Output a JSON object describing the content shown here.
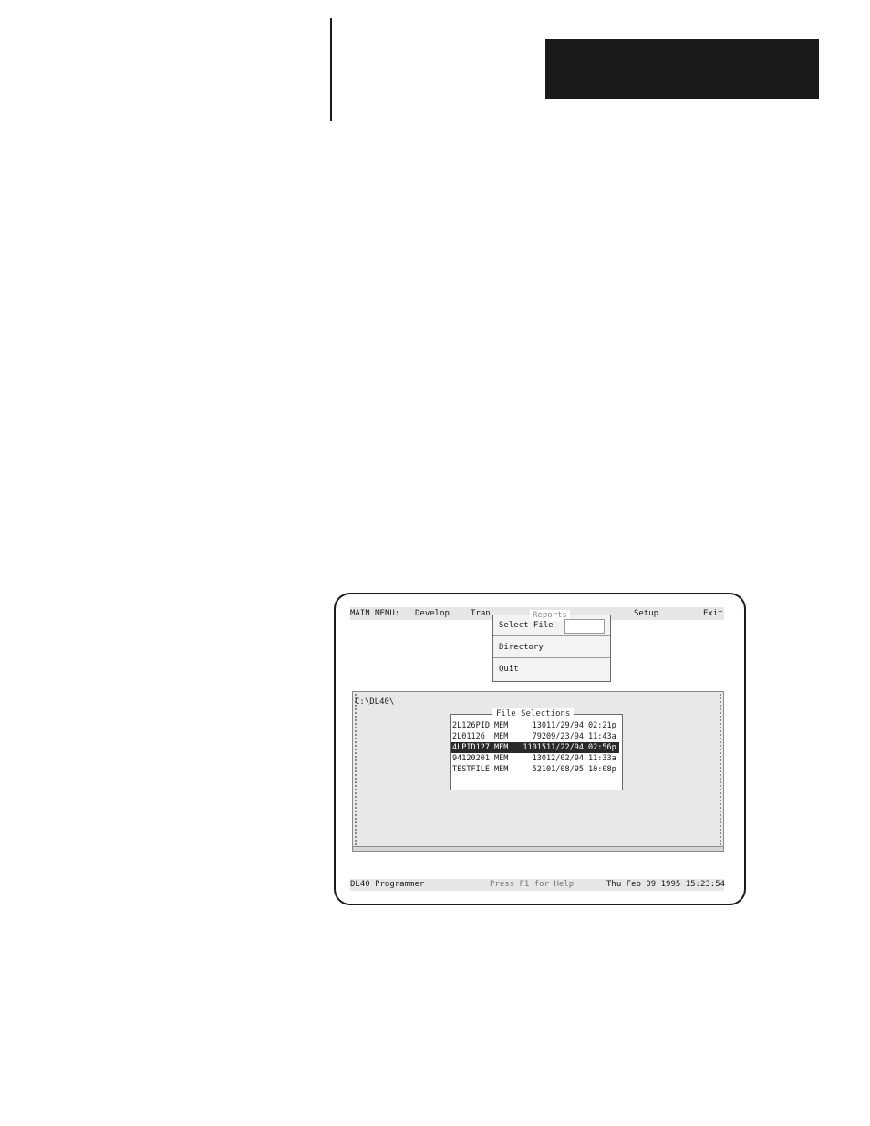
{
  "menu": {
    "main_label": "MAIN MENU:",
    "develop": "Develop",
    "tran": "Tran",
    "setup": "Setup",
    "exit": "Exit"
  },
  "reports_menu": {
    "title": "Reports",
    "items": [
      "Select File",
      "Directory",
      "Quit"
    ]
  },
  "directory": {
    "path": "C:\\DL40\\"
  },
  "file_selections": {
    "title": "File Selections",
    "rows": [
      {
        "name": "2L126PID.MEM",
        "size": "130",
        "date": "11/29/94",
        "time": "02:21p",
        "selected": false
      },
      {
        "name": "2L01126 .MEM",
        "size": "792",
        "date": "09/23/94",
        "time": "11:43a",
        "selected": false
      },
      {
        "name": "4LPID127.MEM",
        "size": "11015",
        "date": "11/22/94",
        "time": "02:56p",
        "selected": true
      },
      {
        "name": "94120201.MEM",
        "size": "130",
        "date": "12/02/94",
        "time": "11:33a",
        "selected": false
      },
      {
        "name": "TESTFILE.MEM",
        "size": "521",
        "date": "01/08/95",
        "time": "10:08p",
        "selected": false
      }
    ]
  },
  "status": {
    "app": "DL40 Programmer",
    "help": "Press F1 for Help",
    "datetime": "Thu Feb 09 1995 15:23:54"
  }
}
